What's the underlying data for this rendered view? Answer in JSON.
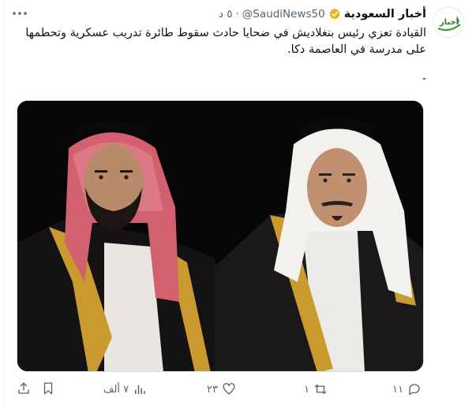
{
  "account": {
    "name": "أخبار السعودية",
    "handle": "@SaudiNews50",
    "time": "٥ د",
    "avatar_text": "أخبار",
    "verified": true
  },
  "tweet": {
    "text": "القيادة تعزي رئيس بنغلاديش في ضحايا حادث سقوط طائرة تدريب عسكرية وتحطمها على مدرسة في العاصمة دكا.",
    "separator": "-"
  },
  "actions": {
    "replies": "١١",
    "reposts": "١",
    "likes": "٢٣",
    "views": "٧ ألف"
  },
  "icons": {
    "more": "more-dots-icon",
    "reply": "reply-bubble-icon",
    "repost": "repost-arrows-icon",
    "like": "heart-icon",
    "views": "views-bars-icon",
    "bookmark": "bookmark-icon",
    "share": "share-upload-icon"
  },
  "colors": {
    "text": "#0f1419",
    "muted": "#536471",
    "verified_gold": "#e2b719",
    "avatar_green": "#3f9b3a"
  }
}
